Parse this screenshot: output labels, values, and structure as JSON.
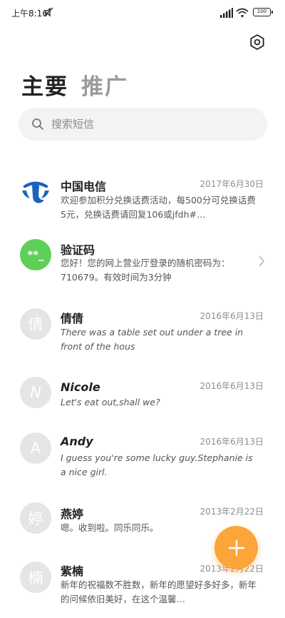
{
  "status_bar": {
    "time": "上午8:16",
    "battery": "100",
    "icons": [
      "mute-icon",
      "signal-icon",
      "wifi-icon",
      "battery-icon"
    ]
  },
  "header": {
    "settings_icon": "gear-icon",
    "tabs": [
      {
        "label": "主要",
        "active": true
      },
      {
        "label": "推广",
        "active": false
      }
    ]
  },
  "search": {
    "placeholder": "搜索短信",
    "icon": "search-icon"
  },
  "messages": [
    {
      "name": "中国电信",
      "date": "2017年6月30日",
      "body": "欢迎参加积分兑换话费活动，每500分可兑换话费5元，兑换话费请回复106或jfdh#…",
      "avatar_type": "telecom-logo"
    },
    {
      "name": "验证码",
      "date": "",
      "body": "您好！您的网上营业厅登录的随机密码为：710679。有效时间为3分钟",
      "avatar_text": "**_",
      "avatar_type": "code"
    },
    {
      "name": "倩倩",
      "date": "2016年6月13日",
      "body": "There was a table set out under a tree in front of the hous",
      "avatar_text": "倩"
    },
    {
      "name": "Nicole",
      "date": "2016年6月13日",
      "body": "Let's eat out,shall we?",
      "avatar_text": "N"
    },
    {
      "name": "Andy",
      "date": "2016年6月13日",
      "body": "I guess you're some lucky guy.Stephanie is a nice girl.",
      "avatar_text": "A"
    },
    {
      "name": "燕婷",
      "date": "2013年2月22日",
      "body": "嗯。收到啦。同乐同乐。",
      "avatar_text": "婷"
    },
    {
      "name": "紫楠",
      "date": "2013年2月22日",
      "body": "新年的祝福数不胜数，新年的愿望好多好多，新年的问候依旧美好，在这个温馨…",
      "avatar_text": "楠"
    }
  ],
  "colors": {
    "accent_fab": "#fba53a",
    "avatar_grey": "#e5e5e5",
    "avatar_green": "#5ecf58",
    "telecom_blue": "#1a62c0"
  },
  "fab": {
    "icon": "plus-icon"
  }
}
